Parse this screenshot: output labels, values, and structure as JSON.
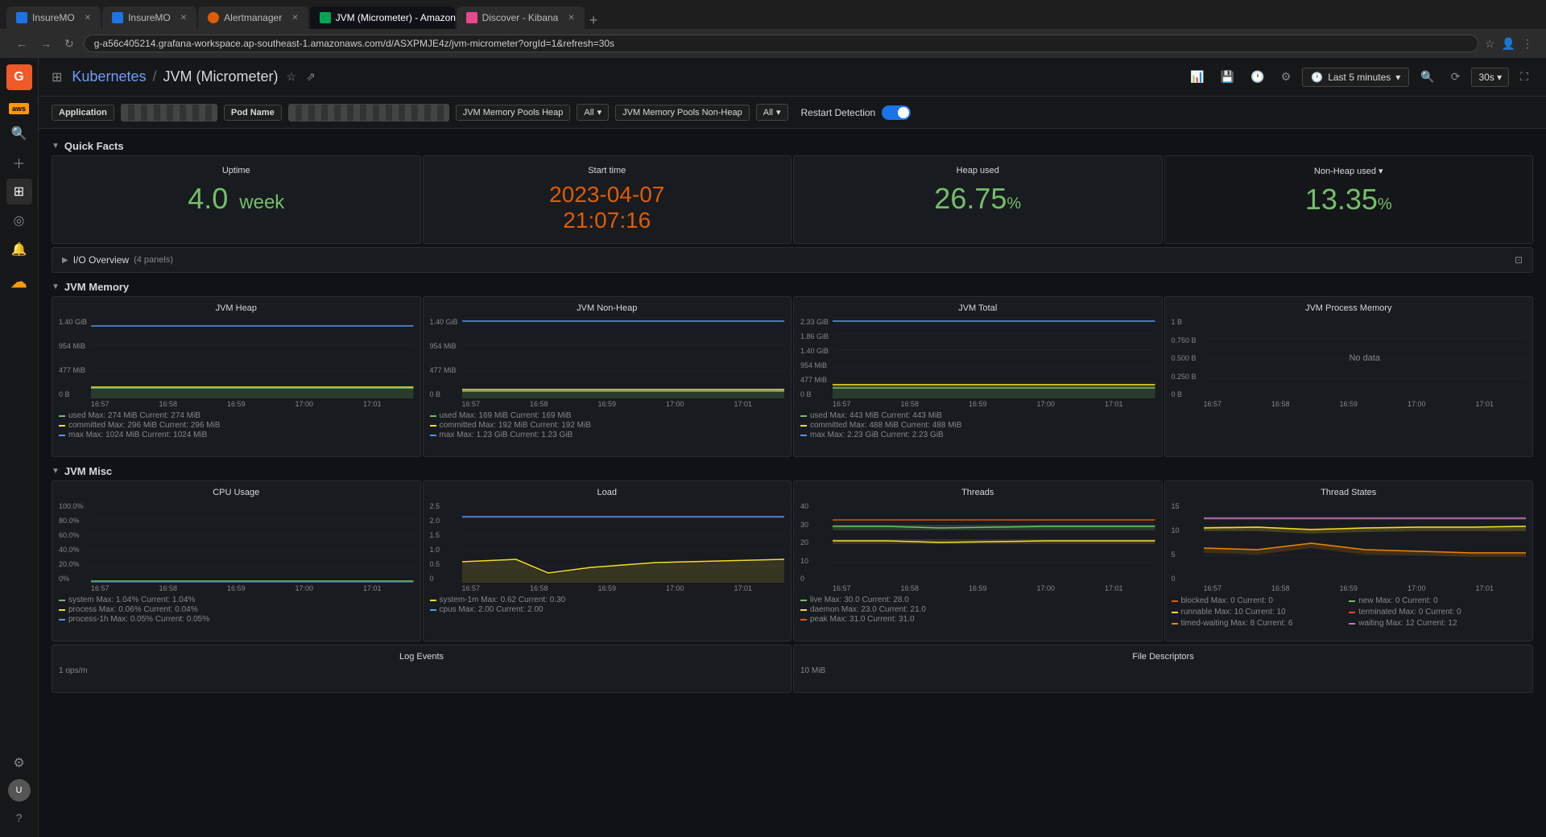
{
  "browser": {
    "tabs": [
      {
        "label": "InsureMO",
        "type": "blue",
        "active": false
      },
      {
        "label": "InsureMO",
        "type": "blue",
        "active": false
      },
      {
        "label": "Alertmanager",
        "type": "orange",
        "active": false
      },
      {
        "label": "JVM (Micrometer) - Amazon ...",
        "type": "green",
        "active": true
      },
      {
        "label": "Discover - Kibana",
        "type": "kibana",
        "active": false
      }
    ],
    "url": "g-a56c405214.grafana-workspace.ap-southeast-1.amazonaws.com/d/ASXPMJE4z/jvm-micrometer?orgId=1&refresh=30s"
  },
  "topbar": {
    "breadcrumb_kubernetes": "Kubernetes",
    "breadcrumb_sep": "/",
    "breadcrumb_dashboard": "JVM (Micrometer)",
    "time_range": "Last 5 minutes",
    "refresh": "30s"
  },
  "filters": {
    "application_label": "Application",
    "application_value": "",
    "pod_name_label": "Pod Name",
    "pod_name_value": "",
    "jvm_heap_label": "JVM Memory Pools Heap",
    "jvm_heap_value": "All",
    "jvm_nonheap_label": "JVM Memory Pools Non-Heap",
    "jvm_nonheap_value": "All",
    "restart_detection_label": "Restart Detection",
    "toggle_state": "on"
  },
  "quick_facts": {
    "section_label": "Quick Facts",
    "uptime_label": "Uptime",
    "uptime_value": "4.0",
    "uptime_unit": "week",
    "start_time_label": "Start time",
    "start_time_value": "2023-04-07",
    "start_time_value2": "21:07:16",
    "heap_used_label": "Heap used",
    "heap_used_value": "26.75",
    "heap_used_unit": "%",
    "non_heap_used_label": "Non-Heap used",
    "non_heap_used_value": "13.35",
    "non_heap_used_unit": "%"
  },
  "io_overview": {
    "section_label": "I/O Overview",
    "panels_count": "(4 panels)"
  },
  "jvm_memory": {
    "section_label": "JVM Memory",
    "heap_title": "JVM Heap",
    "nonheap_title": "JVM Non-Heap",
    "total_title": "JVM Total",
    "process_title": "JVM Process Memory",
    "heap_y": [
      "1.40 GiB",
      "954 MiB",
      "477 MiB",
      "0 B"
    ],
    "heap_x": [
      "16:57",
      "16:58",
      "16:59",
      "17:00",
      "17:01"
    ],
    "heap_legend": [
      {
        "color": "#73bf69",
        "label": "used  Max: 274 MiB  Current: 274 MiB"
      },
      {
        "color": "#fade2a",
        "label": "committed  Max: 296 MiB  Current: 296 MiB"
      },
      {
        "color": "#5794f2",
        "label": "max  Max: 1024 MiB  Current: 1024 MiB"
      }
    ],
    "nonheap_y": [
      "1.40 GiB",
      "954 MiB",
      "477 MiB",
      "0 B"
    ],
    "nonheap_x": [
      "16:57",
      "16:58",
      "16:59",
      "17:00",
      "17:01"
    ],
    "nonheap_legend": [
      {
        "color": "#73bf69",
        "label": "used  Max: 169 MiB  Current: 169 MiB"
      },
      {
        "color": "#fade2a",
        "label": "committed  Max: 192 MiB  Current: 192 MiB"
      },
      {
        "color": "#5794f2",
        "label": "max  Max: 1.23 GiB  Current: 1.23 GiB"
      }
    ],
    "total_y": [
      "2.33 GiB",
      "1.86 GiB",
      "1.40 GiB",
      "954 MiB",
      "477 MiB",
      "0 B"
    ],
    "total_x": [
      "16:57",
      "16:58",
      "16:59",
      "17:00",
      "17:01"
    ],
    "total_legend": [
      {
        "color": "#73bf69",
        "label": "used  Max: 443 MiB  Current: 443 MiB"
      },
      {
        "color": "#fade2a",
        "label": "committed  Max: 488 MiB  Current: 488 MiB"
      },
      {
        "color": "#5794f2",
        "label": "max  Max: 2.23 GiB  Current: 2.23 GiB"
      }
    ],
    "process_y": [
      "1 B",
      "0.750 B",
      "0.500 B",
      "0.250 B",
      "0 B"
    ],
    "process_x": [
      "16:57",
      "16:58",
      "16:59",
      "17:00",
      "17:01"
    ],
    "process_no_data": "No data"
  },
  "jvm_misc": {
    "section_label": "JVM Misc",
    "cpu_title": "CPU Usage",
    "load_title": "Load",
    "threads_title": "Threads",
    "thread_states_title": "Thread States",
    "cpu_y": [
      "100.0%",
      "80.0%",
      "60.0%",
      "40.0%",
      "20.0%",
      "0%"
    ],
    "cpu_x": [
      "16:57",
      "16:58",
      "16:59",
      "17:00",
      "17:01"
    ],
    "cpu_legend": [
      {
        "color": "#73bf69",
        "label": "system  Max: 1.04%  Current: 1.04%"
      },
      {
        "color": "#fade2a",
        "label": "process  Max: 0.06%  Current: 0.04%"
      },
      {
        "color": "#5794f2",
        "label": "process-1h  Max: 0.05%  Current: 0.05%"
      }
    ],
    "load_y": [
      "2.5",
      "2.0",
      "1.5",
      "1.0",
      "0.5",
      "0"
    ],
    "load_x": [
      "16:57",
      "16:58",
      "16:59",
      "17:00",
      "17:01"
    ],
    "load_legend": [
      {
        "color": "#fade2a",
        "label": "system-1m  Max: 0.62  Current: 0.30"
      },
      {
        "color": "#5794f2",
        "label": "cpus  Max: 2.00  Current: 2.00"
      }
    ],
    "threads_y": [
      "40",
      "30",
      "20",
      "10",
      "0"
    ],
    "threads_x": [
      "16:57",
      "16:58",
      "16:59",
      "17:00",
      "17:01"
    ],
    "threads_legend": [
      {
        "color": "#73bf69",
        "label": "live  Max: 30.0  Current: 28.0"
      },
      {
        "color": "#fade2a",
        "label": "daemon  Max: 23.0  Current: 21.0"
      },
      {
        "color": "#e05c00",
        "label": "peak  Max: 31.0  Current: 31.0"
      }
    ],
    "ts_y": [
      "15",
      "10",
      "5",
      "0"
    ],
    "ts_x": [
      "16:57",
      "16:58",
      "16:59",
      "17:00",
      "17:01"
    ],
    "ts_legend": [
      {
        "color": "#e05c00",
        "label": "blocked  Max: 0  Current: 0"
      },
      {
        "color": "#73bf69",
        "label": "new  Max: 0  Current: 0"
      },
      {
        "color": "#fade2a",
        "label": "runnable  Max: 10  Current: 10"
      },
      {
        "color": "#ff4040",
        "label": "terminated  Max: 0  Current: 0"
      },
      {
        "color": "#e88400",
        "label": "timed-waiting  Max: 8  Current: 6"
      },
      {
        "color": "#c875c4",
        "label": "waiting  Max: 12  Current: 12"
      }
    ]
  },
  "bottom": {
    "log_events_title": "Log Events",
    "log_events_unit": "1 ops/m",
    "file_desc_title": "File Descriptors",
    "file_desc_unit": "10 MiB"
  },
  "sidebar": {
    "icons": [
      "⊞",
      "🔍",
      "＋",
      "⊞",
      "◎",
      "🔔",
      "☁",
      "⚙"
    ],
    "avatar_initials": "U"
  }
}
